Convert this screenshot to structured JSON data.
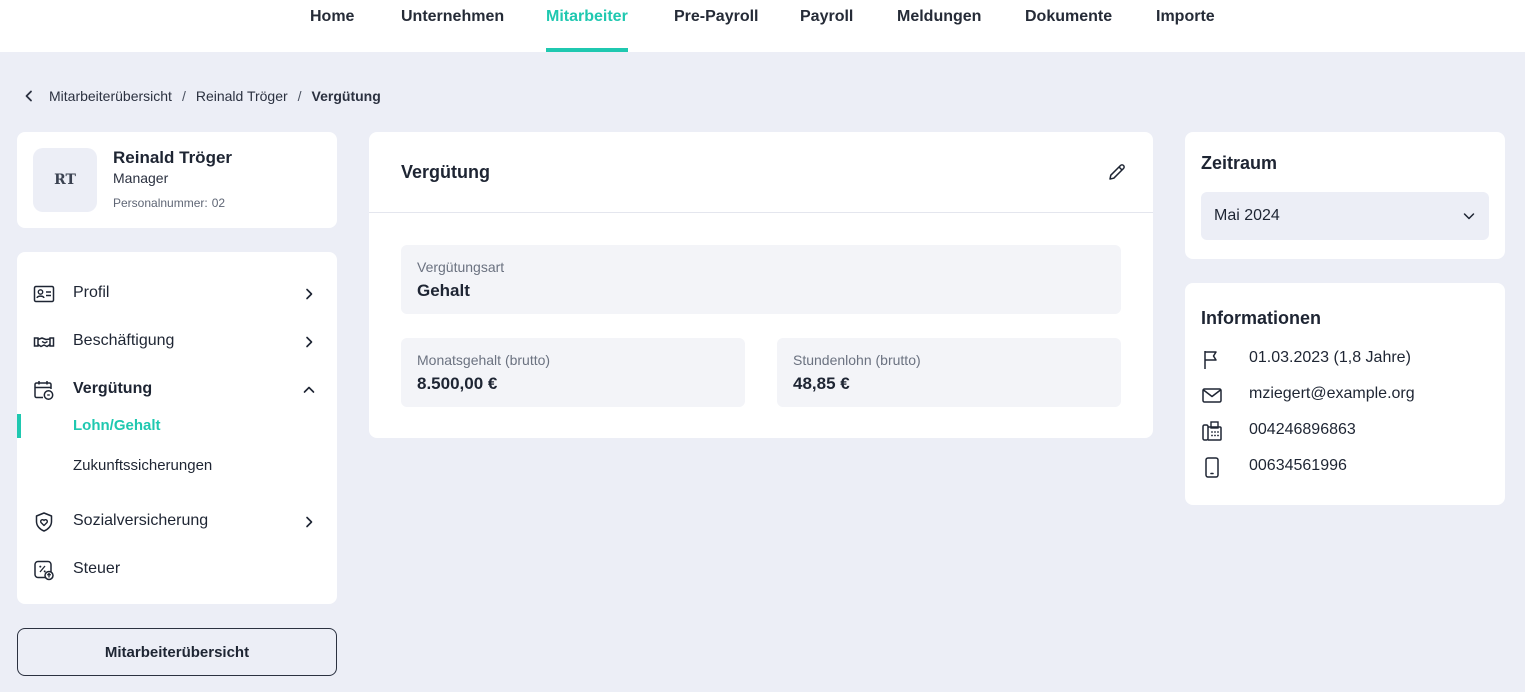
{
  "nav": {
    "tabs": [
      {
        "label": "Home"
      },
      {
        "label": "Unternehmen"
      },
      {
        "label": "Mitarbeiter",
        "active": true
      },
      {
        "label": "Pre-Payroll"
      },
      {
        "label": "Payroll"
      },
      {
        "label": "Meldungen"
      },
      {
        "label": "Dokumente"
      },
      {
        "label": "Importe"
      }
    ]
  },
  "breadcrumb": {
    "items": [
      "Mitarbeiterübersicht",
      "Reinald Tröger"
    ],
    "current": "Vergütung",
    "separator": "/"
  },
  "profile": {
    "initials": "RT",
    "name": "Reinald Tröger",
    "role": "Manager",
    "personnel_label": "Personalnummer:",
    "personnel_number": "02"
  },
  "sidebar": {
    "items": [
      {
        "label": "Profil",
        "icon": "id-card-icon"
      },
      {
        "label": "Beschäftigung",
        "icon": "handshake-icon"
      },
      {
        "label": "Vergütung",
        "icon": "calendar-money-icon",
        "expanded": true
      },
      {
        "label": "Sozialversicherung",
        "icon": "shield-icon"
      },
      {
        "label": "Steuer",
        "icon": "tax-percent-icon"
      }
    ],
    "subitems": [
      {
        "label": "Lohn/Gehalt",
        "active": true
      },
      {
        "label": "Zukunftssicherungen"
      }
    ],
    "overview_button": "Mitarbeiterübersicht"
  },
  "main": {
    "title": "Vergütung",
    "fields": {
      "type_label": "Vergütungsart",
      "type_value": "Gehalt",
      "monthly_label": "Monatsgehalt (brutto)",
      "monthly_value": "8.500,00 €",
      "hourly_label": "Stundenlohn (brutto)",
      "hourly_value": "48,85 €"
    }
  },
  "period": {
    "title": "Zeitraum",
    "selected": "Mai 2024"
  },
  "info": {
    "title": "Informationen",
    "rows": [
      {
        "icon": "flag-icon",
        "text": "01.03.2023 (1,8 Jahre)"
      },
      {
        "icon": "mail-icon",
        "text": "mziegert@example.org"
      },
      {
        "icon": "phone-icon",
        "text": "004246896863"
      },
      {
        "icon": "mobile-icon",
        "text": "00634561996"
      }
    ]
  },
  "colors": {
    "accent": "#1fc8b0",
    "background": "#eceef6",
    "text": "#1e2533"
  }
}
